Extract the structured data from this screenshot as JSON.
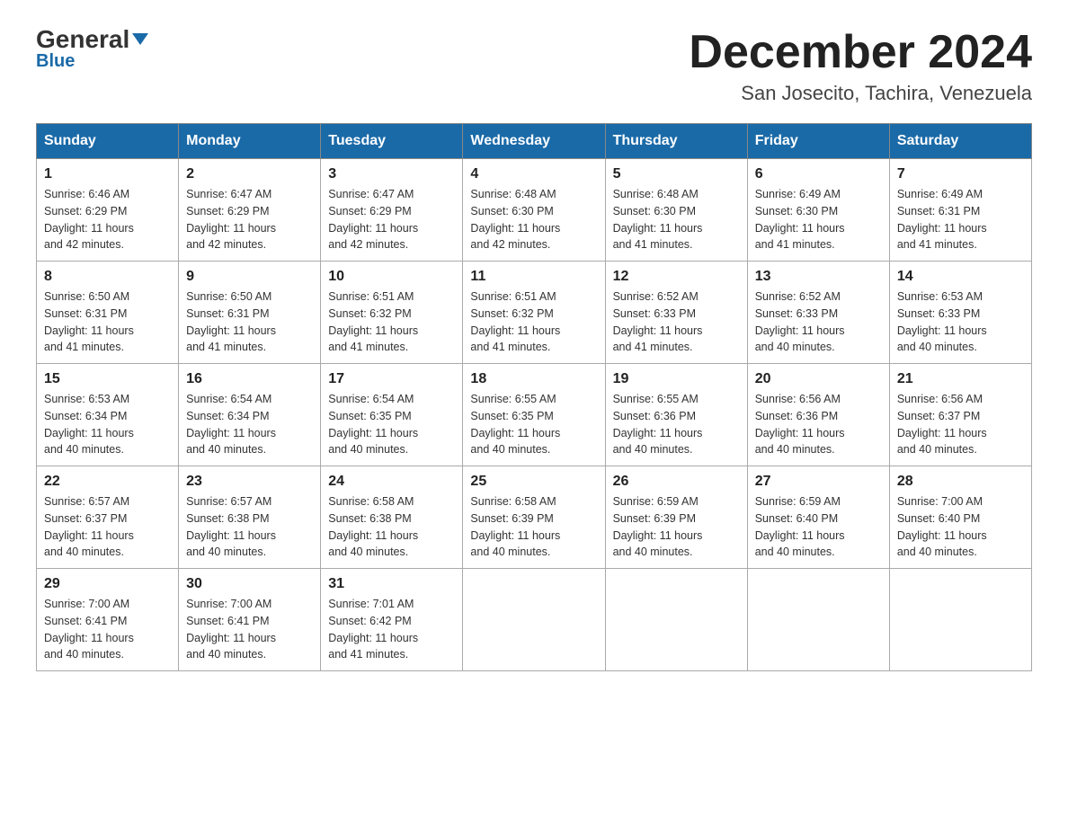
{
  "header": {
    "logo_general": "General",
    "logo_blue": "Blue",
    "title": "December 2024",
    "location": "San Josecito, Tachira, Venezuela"
  },
  "calendar": {
    "days_of_week": [
      "Sunday",
      "Monday",
      "Tuesday",
      "Wednesday",
      "Thursday",
      "Friday",
      "Saturday"
    ],
    "weeks": [
      [
        {
          "day": "1",
          "sunrise": "Sunrise: 6:46 AM",
          "sunset": "Sunset: 6:29 PM",
          "daylight": "Daylight: 11 hours and 42 minutes."
        },
        {
          "day": "2",
          "sunrise": "Sunrise: 6:47 AM",
          "sunset": "Sunset: 6:29 PM",
          "daylight": "Daylight: 11 hours and 42 minutes."
        },
        {
          "day": "3",
          "sunrise": "Sunrise: 6:47 AM",
          "sunset": "Sunset: 6:29 PM",
          "daylight": "Daylight: 11 hours and 42 minutes."
        },
        {
          "day": "4",
          "sunrise": "Sunrise: 6:48 AM",
          "sunset": "Sunset: 6:30 PM",
          "daylight": "Daylight: 11 hours and 42 minutes."
        },
        {
          "day": "5",
          "sunrise": "Sunrise: 6:48 AM",
          "sunset": "Sunset: 6:30 PM",
          "daylight": "Daylight: 11 hours and 41 minutes."
        },
        {
          "day": "6",
          "sunrise": "Sunrise: 6:49 AM",
          "sunset": "Sunset: 6:30 PM",
          "daylight": "Daylight: 11 hours and 41 minutes."
        },
        {
          "day": "7",
          "sunrise": "Sunrise: 6:49 AM",
          "sunset": "Sunset: 6:31 PM",
          "daylight": "Daylight: 11 hours and 41 minutes."
        }
      ],
      [
        {
          "day": "8",
          "sunrise": "Sunrise: 6:50 AM",
          "sunset": "Sunset: 6:31 PM",
          "daylight": "Daylight: 11 hours and 41 minutes."
        },
        {
          "day": "9",
          "sunrise": "Sunrise: 6:50 AM",
          "sunset": "Sunset: 6:31 PM",
          "daylight": "Daylight: 11 hours and 41 minutes."
        },
        {
          "day": "10",
          "sunrise": "Sunrise: 6:51 AM",
          "sunset": "Sunset: 6:32 PM",
          "daylight": "Daylight: 11 hours and 41 minutes."
        },
        {
          "day": "11",
          "sunrise": "Sunrise: 6:51 AM",
          "sunset": "Sunset: 6:32 PM",
          "daylight": "Daylight: 11 hours and 41 minutes."
        },
        {
          "day": "12",
          "sunrise": "Sunrise: 6:52 AM",
          "sunset": "Sunset: 6:33 PM",
          "daylight": "Daylight: 11 hours and 41 minutes."
        },
        {
          "day": "13",
          "sunrise": "Sunrise: 6:52 AM",
          "sunset": "Sunset: 6:33 PM",
          "daylight": "Daylight: 11 hours and 40 minutes."
        },
        {
          "day": "14",
          "sunrise": "Sunrise: 6:53 AM",
          "sunset": "Sunset: 6:33 PM",
          "daylight": "Daylight: 11 hours and 40 minutes."
        }
      ],
      [
        {
          "day": "15",
          "sunrise": "Sunrise: 6:53 AM",
          "sunset": "Sunset: 6:34 PM",
          "daylight": "Daylight: 11 hours and 40 minutes."
        },
        {
          "day": "16",
          "sunrise": "Sunrise: 6:54 AM",
          "sunset": "Sunset: 6:34 PM",
          "daylight": "Daylight: 11 hours and 40 minutes."
        },
        {
          "day": "17",
          "sunrise": "Sunrise: 6:54 AM",
          "sunset": "Sunset: 6:35 PM",
          "daylight": "Daylight: 11 hours and 40 minutes."
        },
        {
          "day": "18",
          "sunrise": "Sunrise: 6:55 AM",
          "sunset": "Sunset: 6:35 PM",
          "daylight": "Daylight: 11 hours and 40 minutes."
        },
        {
          "day": "19",
          "sunrise": "Sunrise: 6:55 AM",
          "sunset": "Sunset: 6:36 PM",
          "daylight": "Daylight: 11 hours and 40 minutes."
        },
        {
          "day": "20",
          "sunrise": "Sunrise: 6:56 AM",
          "sunset": "Sunset: 6:36 PM",
          "daylight": "Daylight: 11 hours and 40 minutes."
        },
        {
          "day": "21",
          "sunrise": "Sunrise: 6:56 AM",
          "sunset": "Sunset: 6:37 PM",
          "daylight": "Daylight: 11 hours and 40 minutes."
        }
      ],
      [
        {
          "day": "22",
          "sunrise": "Sunrise: 6:57 AM",
          "sunset": "Sunset: 6:37 PM",
          "daylight": "Daylight: 11 hours and 40 minutes."
        },
        {
          "day": "23",
          "sunrise": "Sunrise: 6:57 AM",
          "sunset": "Sunset: 6:38 PM",
          "daylight": "Daylight: 11 hours and 40 minutes."
        },
        {
          "day": "24",
          "sunrise": "Sunrise: 6:58 AM",
          "sunset": "Sunset: 6:38 PM",
          "daylight": "Daylight: 11 hours and 40 minutes."
        },
        {
          "day": "25",
          "sunrise": "Sunrise: 6:58 AM",
          "sunset": "Sunset: 6:39 PM",
          "daylight": "Daylight: 11 hours and 40 minutes."
        },
        {
          "day": "26",
          "sunrise": "Sunrise: 6:59 AM",
          "sunset": "Sunset: 6:39 PM",
          "daylight": "Daylight: 11 hours and 40 minutes."
        },
        {
          "day": "27",
          "sunrise": "Sunrise: 6:59 AM",
          "sunset": "Sunset: 6:40 PM",
          "daylight": "Daylight: 11 hours and 40 minutes."
        },
        {
          "day": "28",
          "sunrise": "Sunrise: 7:00 AM",
          "sunset": "Sunset: 6:40 PM",
          "daylight": "Daylight: 11 hours and 40 minutes."
        }
      ],
      [
        {
          "day": "29",
          "sunrise": "Sunrise: 7:00 AM",
          "sunset": "Sunset: 6:41 PM",
          "daylight": "Daylight: 11 hours and 40 minutes."
        },
        {
          "day": "30",
          "sunrise": "Sunrise: 7:00 AM",
          "sunset": "Sunset: 6:41 PM",
          "daylight": "Daylight: 11 hours and 40 minutes."
        },
        {
          "day": "31",
          "sunrise": "Sunrise: 7:01 AM",
          "sunset": "Sunset: 6:42 PM",
          "daylight": "Daylight: 11 hours and 41 minutes."
        },
        null,
        null,
        null,
        null
      ]
    ]
  }
}
